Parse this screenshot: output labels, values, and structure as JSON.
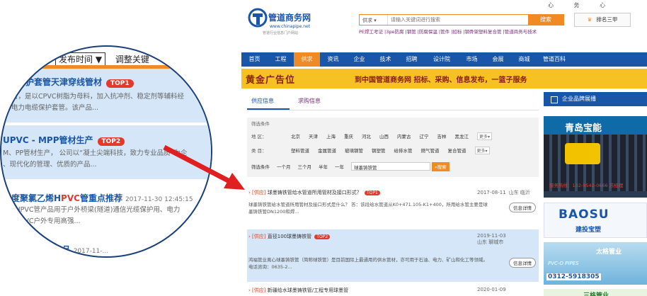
{
  "top_links": [
    "心",
    "务",
    "心"
  ],
  "logo": {
    "name": "管道商务网",
    "url": "www.chinapipe.net",
    "slogan": "管道行业信息门户网站"
  },
  "search": {
    "scope": "供求",
    "placeholder": "请输入关键词进行搜索",
    "button": "搜索"
  },
  "hotwords": [
    "PE焊工考证",
    "3pe防腐",
    "钢管",
    "防腐保温",
    "管件",
    "招标",
    "钢骨架塑料复合管",
    "管道商务与技术"
  ],
  "rank_button": "排名三甲",
  "nav": [
    {
      "label": "首页"
    },
    {
      "label": "工程"
    },
    {
      "label": "供求"
    },
    {
      "label": "资讯"
    },
    {
      "label": "企业"
    },
    {
      "label": "技术"
    },
    {
      "label": "招聘"
    },
    {
      "label": "设计院"
    },
    {
      "label": "市场"
    },
    {
      "label": "会展"
    },
    {
      "label": "商城"
    },
    {
      "label": "管道百科"
    }
  ],
  "banner": {
    "left": "黄金广告位",
    "right": "到中国管道商务网 招标、采购、信息发布，一篮子服务"
  },
  "tabs": {
    "supply": "供应信息",
    "demand": "求购信息"
  },
  "filter": {
    "title": "筛选条件",
    "region_label": "地  区：",
    "regions": [
      "北京",
      "天津",
      "上海",
      "重庆",
      "河北",
      "山西",
      "内蒙古",
      "辽宁",
      "吉林",
      "黑龙江"
    ],
    "category_label": "类  目：",
    "categories": [
      "塑料管道",
      "金属管道",
      "玻璃钢管",
      "钢塑管",
      "给排水管",
      "燃气管道",
      "复合管道"
    ],
    "more": "更多",
    "time_label": "筛选条件",
    "times": [
      "一个月",
      "三个月",
      "半年",
      "一年"
    ],
    "keyword": "球墨铸铁管",
    "search_button": "搜索"
  },
  "items": [
    {
      "tag": "[供应]",
      "title": "球墨铸铁管给水管道所用管材及接口形式？",
      "badge": "TOP1",
      "date": "2017-08-11",
      "location": "山东 临沂",
      "desc": "球墨铸铁管给水管道所用管材及接口形式是什么？   答：该段给水管道从K0+471.105-K1+400，所用给水管主要是球墨铸铁管DN1200和焊...",
      "detail": "信息详情"
    },
    {
      "tag": "[供应]",
      "title": "直径100球墨铸铁管",
      "badge": "TOP2",
      "date": "2019-11-03",
      "location": "山东 聊城市",
      "desc": "鸿福管业离心球墨铸铁管（简称球铁管）是目前国际上最通用的供水管材，亦可用于石油、电力、矿山和化工等领域。电话咨询：0635-2...",
      "detail": "信息详情"
    },
    {
      "tag": "[供应]",
      "title": "新疆给水球墨铸铁管/工程专用球墨管",
      "badge": "",
      "date": "2020-01-09",
      "location": "",
      "desc": "",
      "detail": ""
    }
  ],
  "side": {
    "header": "企业品牌展播",
    "ad1": {
      "name": "青岛宝能",
      "tel": "服务热线：132-9542-0666 苏经理"
    },
    "ad2": {
      "name": "BAOSU",
      "sub": "建投宝塑"
    },
    "ad3": {
      "name": "太格管业",
      "sub": "PVC-O PIPES",
      "tel": "0312-5918305"
    },
    "ad4": {
      "name": "三格管业"
    }
  },
  "zoom": {
    "sort_select": "发布时间",
    "sort_label": "调整关键",
    "items": [
      {
        "title": "电力护套管天津穿线管材",
        "badge": "TOP1",
        "line1": "管，是以CPVC树脂为母料，加入抗冲剂、稳定剂等辅料经",
        "line2": "电力电缆保护套管。该产品..."
      },
      {
        "title": "UPVC - MPP管材生产",
        "badge": "TOP2",
        "line1": "M、PP管材生产，   公司以“凝土尖端科技，致力专业品质”为企",
        "line2": "、现代化的管理、优质的产品..."
      },
      {
        "title_pre": "强度聚氯乙烯H",
        "title_red": "PVC",
        "title_post": "管重点推荐",
        "date": "2017-11-30 12:45:15",
        "line1": "是HPVC管产品用于户外桥梁(隧道)通信光缆保护用、电力",
        "line2": "、HPVC户外专用高强..."
      },
      {
        "title": "...产品",
        "date": "2017-11-..."
      }
    ]
  }
}
